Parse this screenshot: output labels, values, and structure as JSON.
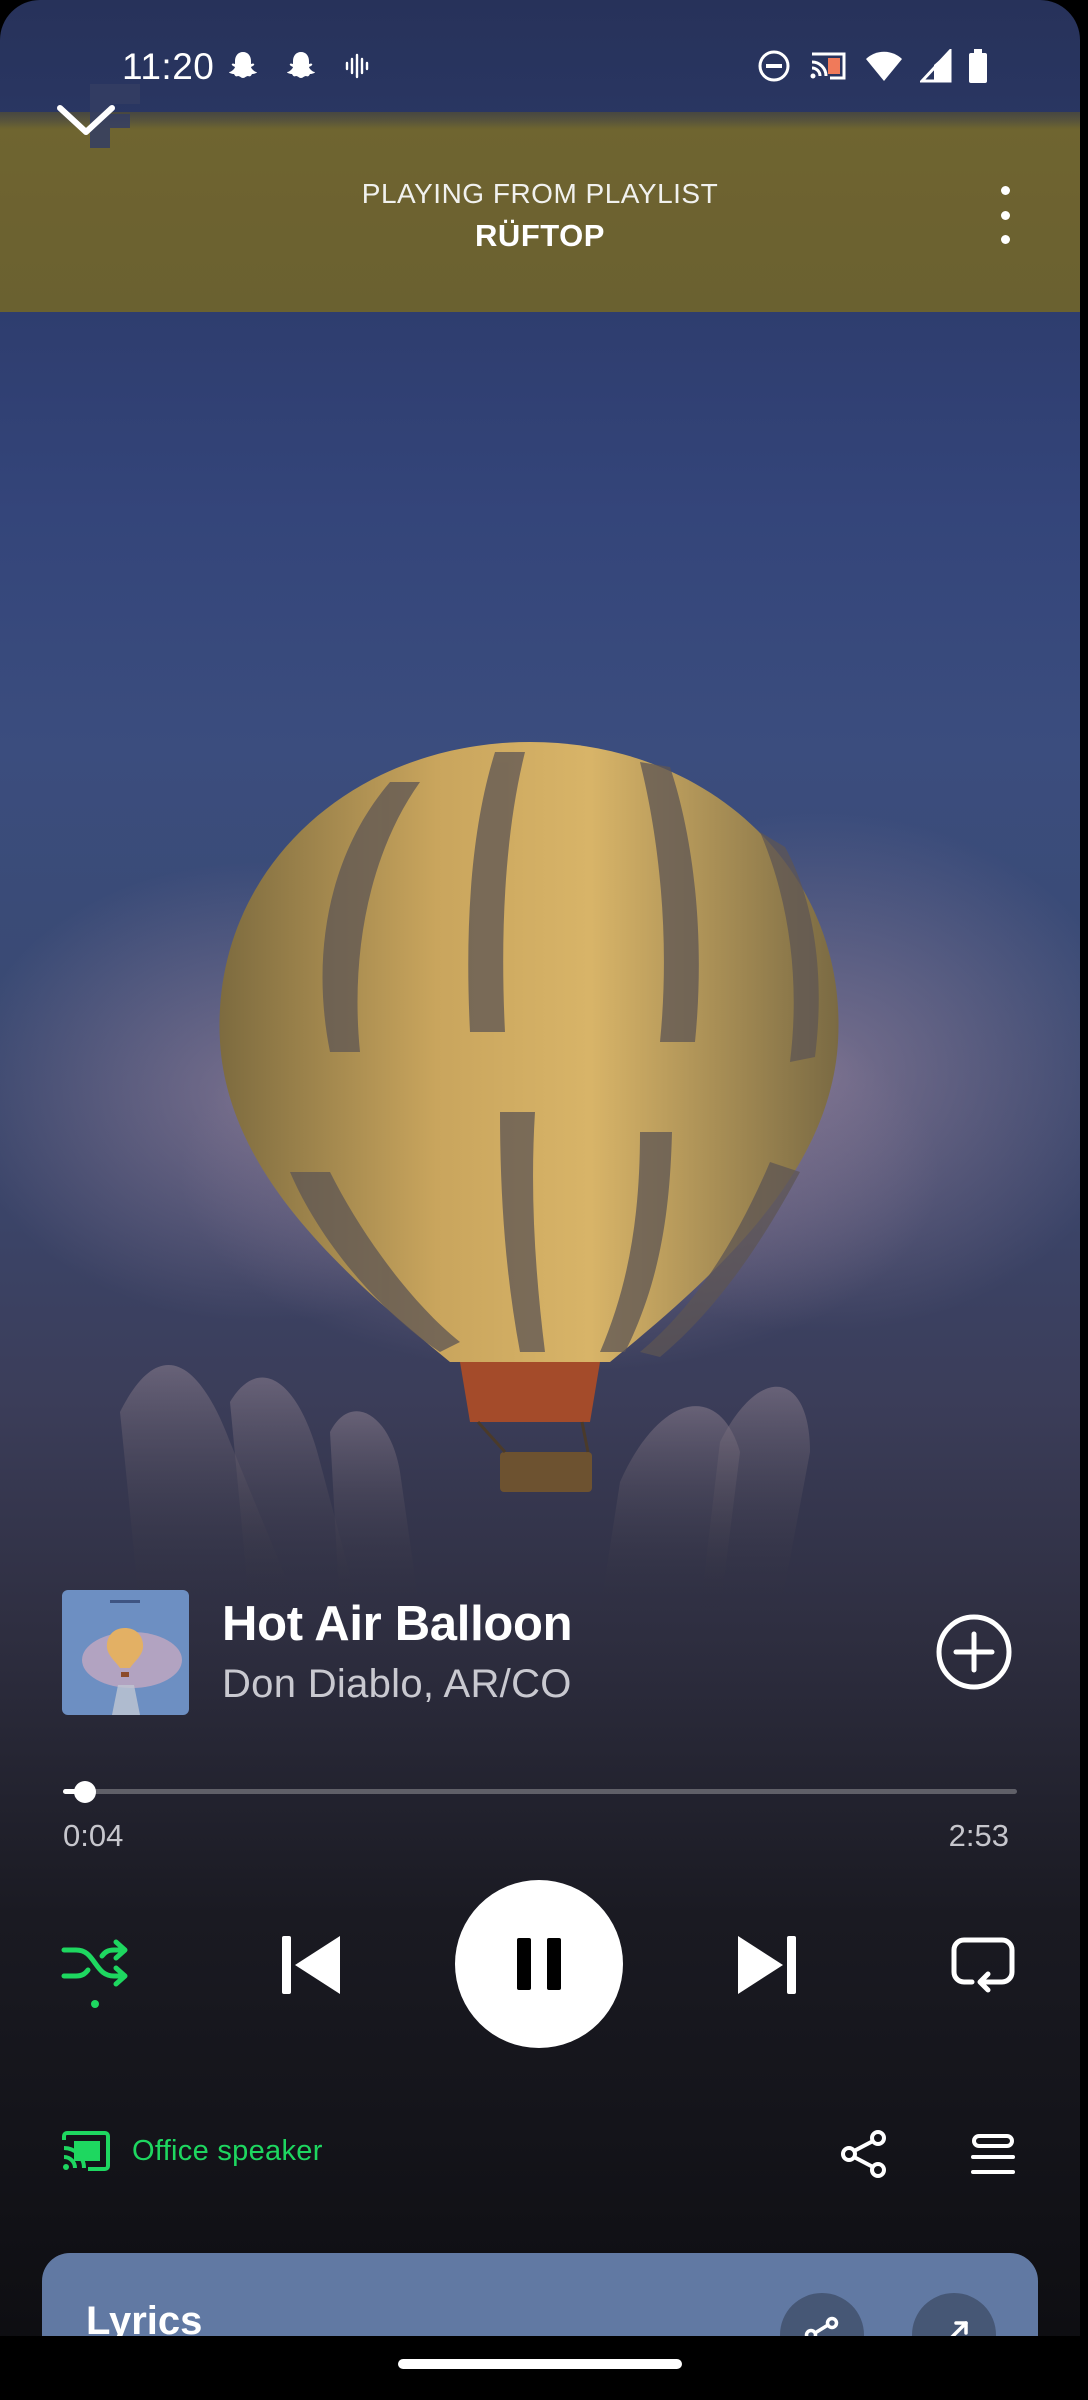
{
  "status_bar": {
    "time": "11:20",
    "left_icons": [
      "snapchat-icon",
      "snapchat-icon",
      "voice-recorder-icon"
    ],
    "right_icons": [
      "do-not-disturb-icon",
      "cast-icon",
      "wifi-icon",
      "cellular-signal-icon",
      "battery-icon"
    ]
  },
  "header": {
    "context_label": "PLAYING FROM PLAYLIST",
    "playlist_name": "RÜFTOP",
    "collapse_icon": "chevron-down-icon",
    "menu_icon": "more-vertical-icon"
  },
  "track": {
    "title": "Hot Air Balloon",
    "artist": "Don Diablo, AR/CO",
    "add_icon": "add-circle-icon"
  },
  "progress": {
    "elapsed": "0:04",
    "total": "2:53",
    "fraction": 0.023
  },
  "controls": {
    "shuffle": {
      "icon": "shuffle-icon",
      "active": true
    },
    "previous": {
      "icon": "skip-previous-icon"
    },
    "play_pause": {
      "icon": "pause-icon"
    },
    "next": {
      "icon": "skip-next-icon"
    },
    "repeat": {
      "icon": "repeat-icon",
      "active": false
    }
  },
  "device": {
    "label": "Office speaker",
    "icon": "cast-connected-icon"
  },
  "actions": {
    "share_icon": "share-icon",
    "queue_icon": "queue-icon"
  },
  "lyrics": {
    "title": "Lyrics",
    "share_icon": "share-icon",
    "expand_icon": "expand-icon"
  },
  "colors": {
    "accent": "#1ed760",
    "header_band": "#6d6230",
    "lyrics_card": "#6179a3"
  }
}
